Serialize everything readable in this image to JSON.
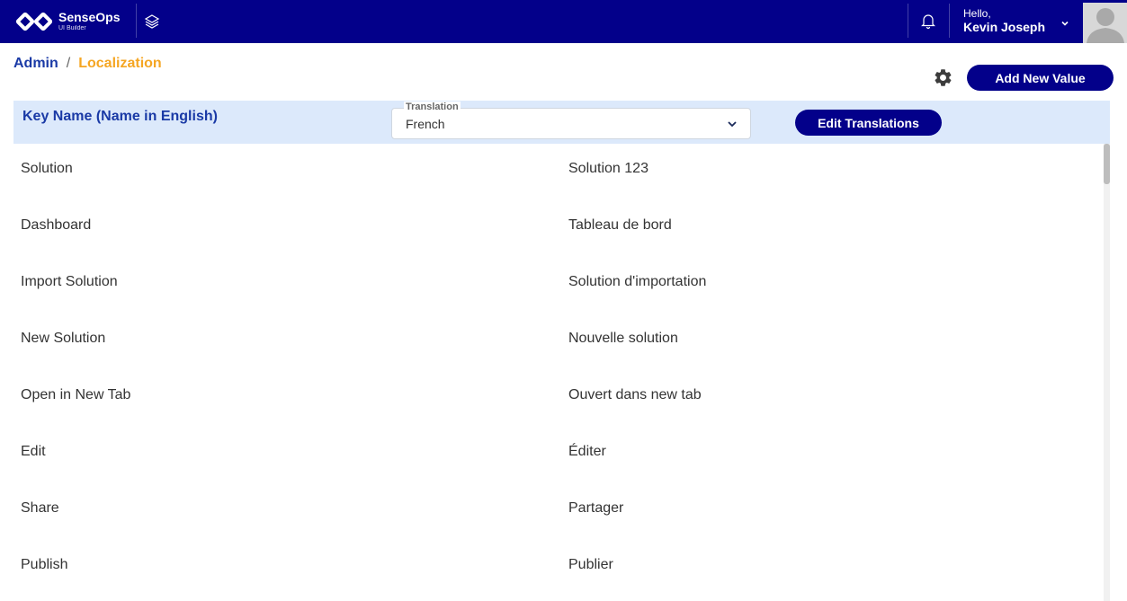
{
  "topbar": {
    "brand_name": "SenseOps",
    "brand_sub": "UI Builder",
    "hello": "Hello,",
    "username": "Kevin Joseph",
    "bg_color": "#03008a"
  },
  "breadcrumb": {
    "admin": "Admin",
    "separator": "/",
    "current": "Localization"
  },
  "toolbar": {
    "add_label": "Add New Value"
  },
  "table": {
    "key_header": "Key Name (Name in English)",
    "translation_legend": "Translation",
    "translation_value": "French",
    "edit_label": "Edit Translations",
    "rows": [
      {
        "key": "Solution",
        "value": "Solution 123"
      },
      {
        "key": "Dashboard",
        "value": "Tableau de bord"
      },
      {
        "key": "Import Solution",
        "value": "Solution d'importation"
      },
      {
        "key": "New Solution",
        "value": "Nouvelle solution"
      },
      {
        "key": "Open in New Tab",
        "value": "Ouvert dans new tab"
      },
      {
        "key": "Edit",
        "value": "Éditer"
      },
      {
        "key": "Share",
        "value": "Partager"
      },
      {
        "key": "Publish",
        "value": "Publier"
      }
    ]
  },
  "icons": {
    "logo": "senseops-logo-icon",
    "layers": "layers-icon",
    "bell": "bell-icon",
    "chevron": "chevron-down-icon",
    "gear": "gear-icon",
    "avatar": "avatar"
  },
  "colors": {
    "accent": "#03008a",
    "link": "#1a3aa6",
    "breadcrumb_current": "#f5a623",
    "header_bg": "#dce9fb"
  }
}
